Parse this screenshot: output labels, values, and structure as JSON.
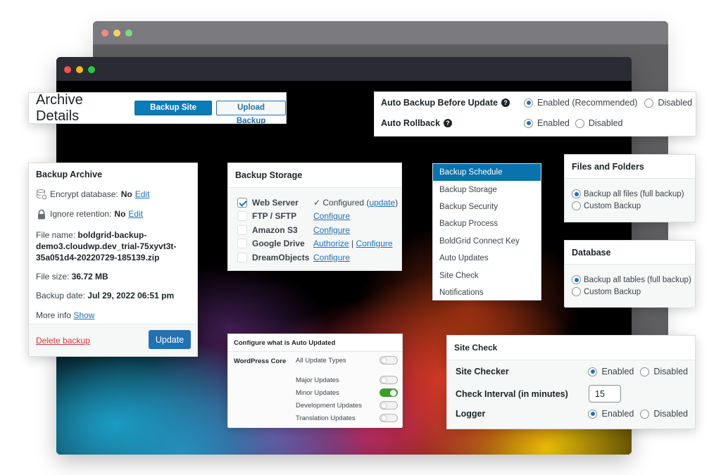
{
  "window_back": {
    "controls": [
      "close",
      "minimize",
      "maximize"
    ]
  },
  "window_front": {
    "controls": [
      "close",
      "minimize",
      "maximize"
    ]
  },
  "archive_header": {
    "title": "Archive Details",
    "backup_now_label": "Backup Site Now",
    "upload_label": "Upload Backup"
  },
  "backup_archive": {
    "title": "Backup Archive",
    "encrypt_label": "Encrypt database:",
    "encrypt_value": "No",
    "encrypt_edit": "Edit",
    "encrypt_icon": "database-lock-icon",
    "retention_label": "Ignore retention:",
    "retention_value": "No",
    "retention_edit": "Edit",
    "retention_icon": "lock-icon",
    "file_name_label": "File name:",
    "file_name_value": "boldgrid-backup-demo3.cloudwp.dev_trial-75xyvt3t-35a051d4-20220729-185139.zip",
    "file_size_label": "File size:",
    "file_size_value": "36.72 MB",
    "backup_date_label": "Backup date:",
    "backup_date_value": "Jul 29, 2022 06:51 pm",
    "more_info_label": "More info",
    "more_info_link": "Show",
    "delete_label": "Delete backup",
    "update_label": "Update"
  },
  "backup_storage": {
    "title": "Backup Storage",
    "items": [
      {
        "name": "Web Server",
        "checked": true,
        "status": "✓ Configured (",
        "link": "update",
        "suffix": ")"
      },
      {
        "name": "FTP / SFTP",
        "checked": false,
        "link": "Configure"
      },
      {
        "name": "Amazon S3",
        "checked": false,
        "link": "Configure"
      },
      {
        "name": "Google Drive",
        "checked": false,
        "link": "Authorize",
        "separator": " | ",
        "link2": "Configure"
      },
      {
        "name": "DreamObjects",
        "checked": false,
        "link": "Configure"
      }
    ]
  },
  "auto_backup": {
    "before_update_label": "Auto Backup Before Update",
    "before_update_options": [
      "Enabled (Recommended)",
      "Disabled"
    ],
    "before_update_selected": "Enabled (Recommended)",
    "rollback_label": "Auto Rollback",
    "rollback_options": [
      "Enabled",
      "Disabled"
    ],
    "rollback_selected": "Enabled",
    "help_icon": "question-circle-icon"
  },
  "nav_menu": {
    "items": [
      {
        "label": "Backup Schedule",
        "active": true
      },
      {
        "label": "Backup Storage",
        "active": false
      },
      {
        "label": "Backup Security",
        "active": false
      },
      {
        "label": "Backup Process",
        "active": false
      },
      {
        "label": "BoldGrid Connect Key",
        "active": false
      },
      {
        "label": "Auto Updates",
        "active": false
      },
      {
        "label": "Site Check",
        "active": false
      },
      {
        "label": "Notifications",
        "active": false
      }
    ]
  },
  "files_folders": {
    "title": "Files and Folders",
    "options": [
      "Backup all files (full backup)",
      "Custom Backup"
    ],
    "selected": "Backup all files (full backup)"
  },
  "database": {
    "title": "Database",
    "options": [
      "Backup all tables (full backup)",
      "Custom Backup"
    ],
    "selected": "Backup all tables (full backup)"
  },
  "auto_updates": {
    "title": "Configure what is Auto Updated",
    "section_label": "WordPress Core",
    "toggles": [
      {
        "label": "All Update Types",
        "on": false
      },
      {
        "label": "Major Updates",
        "on": false
      },
      {
        "label": "Minor Updates",
        "on": true
      },
      {
        "label": "Development Updates",
        "on": false
      },
      {
        "label": "Translation Updates",
        "on": false
      }
    ]
  },
  "site_check": {
    "title": "Site Check",
    "site_checker_label": "Site Checker",
    "site_checker_options": [
      "Enabled",
      "Disabled"
    ],
    "site_checker_selected": "Enabled",
    "interval_label": "Check Interval (in minutes)",
    "interval_value": "15",
    "logger_label": "Logger",
    "logger_options": [
      "Enabled",
      "Disabled"
    ],
    "logger_selected": "Enabled"
  },
  "colors": {
    "primary_blue": "#2271b1",
    "menu_active": "#0a72ad",
    "toggle_on": "#3f9d2e",
    "delete_red": "#d63638"
  }
}
